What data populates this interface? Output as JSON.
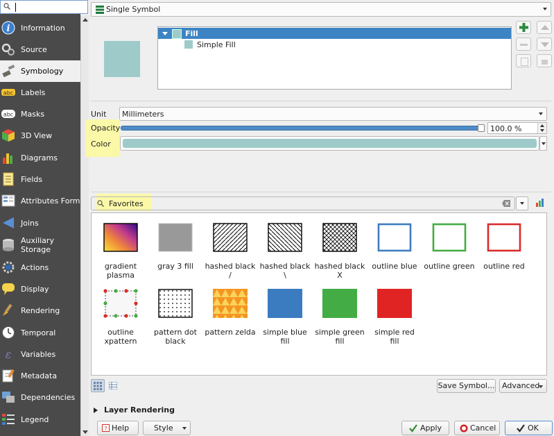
{
  "search": {
    "value": ""
  },
  "sidebar": {
    "items": [
      {
        "label": "Information",
        "icon": "info-icon"
      },
      {
        "label": "Source",
        "icon": "source-icon"
      },
      {
        "label": "Symbology",
        "icon": "paintbrush-icon",
        "selected": true
      },
      {
        "label": "Labels",
        "icon": "labels-icon"
      },
      {
        "label": "Masks",
        "icon": "masks-icon"
      },
      {
        "label": "3D View",
        "icon": "cube-icon"
      },
      {
        "label": "Diagrams",
        "icon": "diagrams-icon"
      },
      {
        "label": "Fields",
        "icon": "fields-icon"
      },
      {
        "label": "Attributes Form",
        "icon": "form-icon"
      },
      {
        "label": "Joins",
        "icon": "joins-icon"
      },
      {
        "label": "Auxiliary\nStorage",
        "icon": "storage-icon"
      },
      {
        "label": "Actions",
        "icon": "gear-icon"
      },
      {
        "label": "Display",
        "icon": "speech-bubble-icon"
      },
      {
        "label": "Rendering",
        "icon": "brush-icon"
      },
      {
        "label": "Temporal",
        "icon": "clock-icon"
      },
      {
        "label": "Variables",
        "icon": "variables-icon"
      },
      {
        "label": "Metadata",
        "icon": "metadata-icon"
      },
      {
        "label": "Dependencies",
        "icon": "dependencies-icon"
      },
      {
        "label": "Legend",
        "icon": "legend-icon"
      }
    ]
  },
  "symbology": {
    "renderer_type": "Single Symbol",
    "colors": {
      "fill": "#9ecbca",
      "accent": "#3c84c4",
      "highlight": "#fbf8a8"
    },
    "tree": {
      "root": "Fill",
      "child": "Simple Fill"
    },
    "unit_label": "Unit",
    "unit_value": "Millimeters",
    "opacity_label": "Opacity",
    "opacity_value": "100.0 %",
    "opacity_level": 1.0,
    "color_label": "Color"
  },
  "library": {
    "search_value": "Favorites",
    "symbols": [
      {
        "name": "gradient plasma",
        "lines": [
          "gradient",
          "plasma"
        ]
      },
      {
        "name": "gray 3 fill",
        "lines": [
          "gray 3 fill",
          ""
        ]
      },
      {
        "name": "hashed black /",
        "lines": [
          "hashed black",
          "/"
        ]
      },
      {
        "name": "hashed black \\",
        "lines": [
          "hashed black",
          "\\"
        ]
      },
      {
        "name": "hashed black X",
        "lines": [
          "hashed black",
          "X"
        ]
      },
      {
        "name": "outline blue",
        "lines": [
          "outline blue",
          ""
        ]
      },
      {
        "name": "outline green",
        "lines": [
          "outline green",
          ""
        ]
      },
      {
        "name": "outline red",
        "lines": [
          "outline red",
          ""
        ]
      },
      {
        "name": "outline xpattern",
        "lines": [
          "outline",
          "xpattern"
        ]
      },
      {
        "name": "pattern dot black",
        "lines": [
          "pattern dot",
          "black"
        ]
      },
      {
        "name": "pattern zelda",
        "lines": [
          "pattern zelda",
          ""
        ]
      },
      {
        "name": "simple blue fill",
        "lines": [
          "simple blue",
          "fill"
        ]
      },
      {
        "name": "simple green fill",
        "lines": [
          "simple green",
          "fill"
        ]
      },
      {
        "name": "simple red fill",
        "lines": [
          "simple red",
          "fill"
        ]
      }
    ],
    "save_symbol": "Save Symbol...",
    "advanced": "Advanced"
  },
  "layer_rendering": "Layer Rendering",
  "footer": {
    "help": "Help",
    "style": "Style",
    "apply": "Apply",
    "cancel": "Cancel",
    "ok": "OK"
  }
}
